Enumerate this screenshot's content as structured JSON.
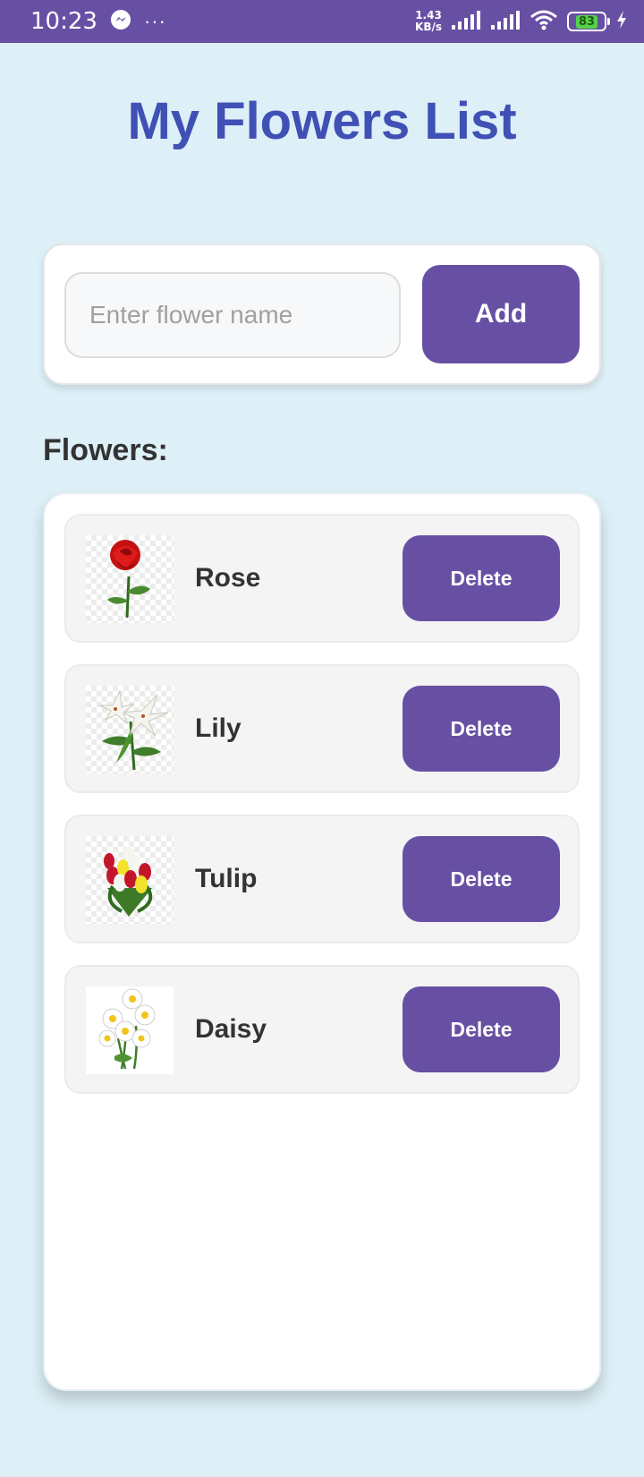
{
  "status_bar": {
    "time": "10:23",
    "more": "···",
    "speed_value": "1.43",
    "speed_unit": "KB/s",
    "battery": "83",
    "icons": [
      "messenger-icon",
      "signal-icon",
      "signal-icon",
      "wifi-icon",
      "battery-icon",
      "charging-icon"
    ]
  },
  "header": {
    "title": "My Flowers List"
  },
  "add_form": {
    "input_value": "",
    "input_placeholder": "Enter flower name",
    "add_label": "Add"
  },
  "list": {
    "heading": "Flowers:",
    "items": [
      {
        "name": "Rose",
        "image_icon": "rose-image",
        "delete_label": "Delete"
      },
      {
        "name": "Lily",
        "image_icon": "lily-image",
        "delete_label": "Delete"
      },
      {
        "name": "Tulip",
        "image_icon": "tulip-image",
        "delete_label": "Delete"
      },
      {
        "name": "Daisy",
        "image_icon": "daisy-image",
        "delete_label": "Delete"
      }
    ]
  },
  "colors": {
    "accent": "#6750a4",
    "title": "#3f51b5",
    "background": "#ddeff7"
  }
}
